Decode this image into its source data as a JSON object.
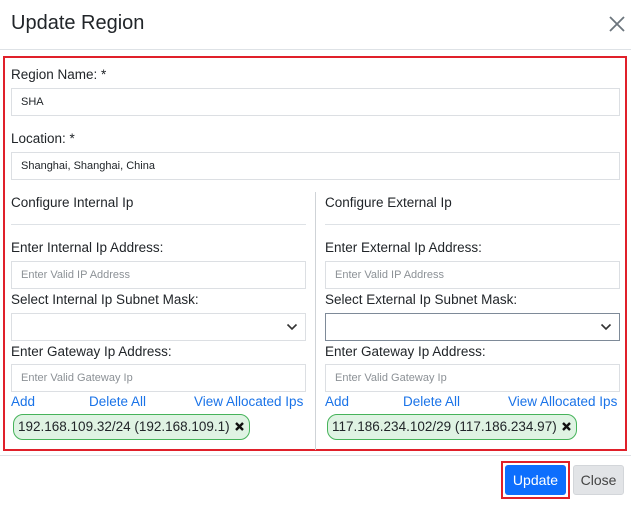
{
  "modal": {
    "title": "Update Region",
    "close_icon": "close-icon"
  },
  "form": {
    "region_name_label": "Region Name: *",
    "region_name_value": "SHA",
    "location_label": "Location: *",
    "location_value": "Shanghai, Shanghai, China"
  },
  "internal": {
    "heading": "Configure Internal Ip",
    "ip_label": "Enter Internal Ip Address:",
    "ip_placeholder": "Enter Valid IP Address",
    "subnet_label": "Select Internal Ip Subnet Mask:",
    "subnet_value": "",
    "gateway_label": "Enter Gateway Ip Address:",
    "gateway_placeholder": "Enter Valid Gateway Ip",
    "add_label": "Add",
    "delete_all_label": "Delete All",
    "view_allocated_label": "View Allocated Ips",
    "chips": [
      "192.168.109.32/24 (192.168.109.1)"
    ]
  },
  "external": {
    "heading": "Configure External Ip",
    "ip_label": "Enter External Ip Address:",
    "ip_placeholder": "Enter Valid IP Address",
    "subnet_label": "Select External Ip Subnet Mask:",
    "subnet_value": "",
    "gateway_label": "Enter Gateway Ip Address:",
    "gateway_placeholder": "Enter Valid Gateway Ip",
    "add_label": "Add",
    "delete_all_label": "Delete All",
    "view_allocated_label": "View Allocated Ips",
    "chips": [
      "117.186.234.102/29 (117.186.234.97)"
    ]
  },
  "footer": {
    "update_label": "Update",
    "close_label": "Close"
  },
  "colors": {
    "primary": "#0d6efd",
    "link": "#1a73e8",
    "highlight_border": "#e0202a",
    "chip_bg": "#dff3e3",
    "chip_border": "#46b35a"
  }
}
